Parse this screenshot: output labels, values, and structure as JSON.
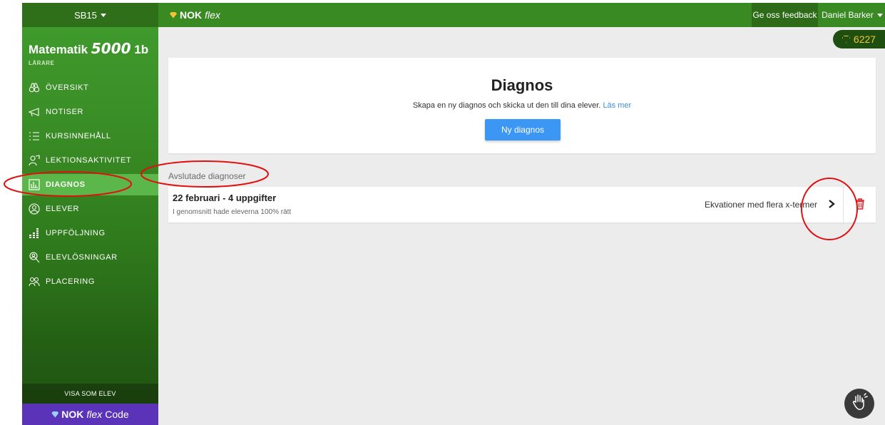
{
  "topbar": {
    "course_switch": "SB15",
    "brand_nok": "NOK",
    "brand_flex": "flex",
    "feedback": "Ge oss feedback",
    "user": "Daniel Barker"
  },
  "points": "6227",
  "sidebar": {
    "course_title": "Matematik",
    "course_number": "5000",
    "course_level": "1b",
    "role": "LÄRARE",
    "items": [
      {
        "label": "ÖVERSIKT",
        "icon": "binoculars-icon"
      },
      {
        "label": "NOTISER",
        "icon": "megaphone-icon"
      },
      {
        "label": "KURSINNEHÅLL",
        "icon": "list-icon"
      },
      {
        "label": "LEKTIONSAKTIVITET",
        "icon": "presenter-icon"
      },
      {
        "label": "DIAGNOS",
        "icon": "diagnos-icon"
      },
      {
        "label": "ELEVER",
        "icon": "student-icon"
      },
      {
        "label": "UPPFÖLJNING",
        "icon": "bar-chart-icon"
      },
      {
        "label": "ELEVLÖSNINGAR",
        "icon": "search-person-icon"
      },
      {
        "label": "PLACERING",
        "icon": "group-icon"
      }
    ],
    "active_index": 4,
    "visa": "VISA SOM ELEV",
    "code_nok": "NOK",
    "code_flex": "flex",
    "code_label": "Code"
  },
  "main": {
    "title": "Diagnos",
    "description": "Skapa en ny diagnos och skicka ut den till dina elever.",
    "read_more": "Läs mer",
    "new_button": "Ny diagnos",
    "section_label": "Avslutade diagnoser",
    "diagnoses": [
      {
        "title": "22 februari - 4 uppgifter",
        "summary": "I genomsnitt hade eleverna 100% rätt",
        "topic": "Ekvationer med flera x-termer"
      }
    ]
  },
  "colors": {
    "topbar": "#3a8a23",
    "sidebar_active": "#5cb74a",
    "primary_button": "#3b97f3",
    "code_bar": "#5a33b8",
    "trash": "#d9262b",
    "annotation": "#e01010"
  }
}
